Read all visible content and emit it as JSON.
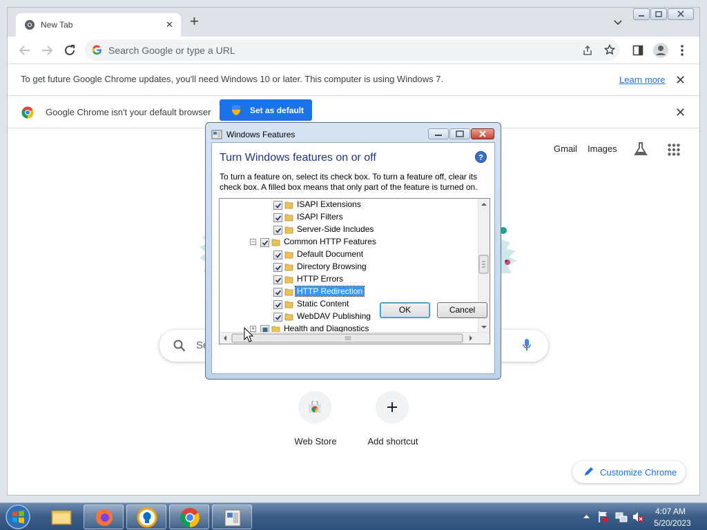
{
  "browser": {
    "tab": {
      "title": "New Tab",
      "close_glyph": "✕",
      "new_tab_glyph": "+"
    },
    "omnibox": {
      "placeholder": "Search Google or type a URL"
    },
    "win7_bar": {
      "text": "To get future Google Chrome updates, you'll need Windows 10 or later. This computer is using Windows 7.",
      "link": "Learn more",
      "close_glyph": "✕"
    },
    "default_bar": {
      "text": "Google Chrome isn't your default browser",
      "button": "Set as default",
      "close_glyph": "✕"
    }
  },
  "ntp": {
    "header_links": [
      "Gmail",
      "Images"
    ],
    "search_placeholder_fragment": "Se",
    "shortcuts": [
      {
        "label": "Web Store",
        "icon": "web-store-icon"
      },
      {
        "label": "Add shortcut",
        "icon": "plus-icon"
      }
    ],
    "customize": "Customize Chrome"
  },
  "dialog": {
    "title": "Windows Features",
    "heading": "Turn Windows features on or off",
    "description": "To turn a feature on, select its check box. To turn a feature off, clear its check box. A filled box means that only part of the feature is turned on.",
    "tree": [
      {
        "label": "ISAPI Extensions",
        "level": 2,
        "state": "checked"
      },
      {
        "label": "ISAPI Filters",
        "level": 2,
        "state": "checked"
      },
      {
        "label": "Server-Side Includes",
        "level": 2,
        "state": "checked"
      },
      {
        "label": "Common HTTP Features",
        "level": 1,
        "state": "checked",
        "expander": "−"
      },
      {
        "label": "Default Document",
        "level": 2,
        "state": "checked"
      },
      {
        "label": "Directory Browsing",
        "level": 2,
        "state": "checked"
      },
      {
        "label": "HTTP Errors",
        "level": 2,
        "state": "checked"
      },
      {
        "label": "HTTP Redirection",
        "level": 2,
        "state": "checked",
        "selected": true
      },
      {
        "label": "Static Content",
        "level": 2,
        "state": "checked"
      },
      {
        "label": "WebDAV Publishing",
        "level": 2,
        "state": "checked"
      },
      {
        "label": "Health and Diagnostics",
        "level": 1,
        "state": "partial",
        "expander": "+"
      }
    ],
    "ok": "OK",
    "cancel": "Cancel"
  },
  "taskbar": {
    "items": [
      "start-orb",
      "explorer-icon",
      "firefox-icon",
      "vpn-icon",
      "chrome-icon",
      "windows-features-icon"
    ],
    "time": "4:07 AM",
    "date": "5/20/2023"
  }
}
